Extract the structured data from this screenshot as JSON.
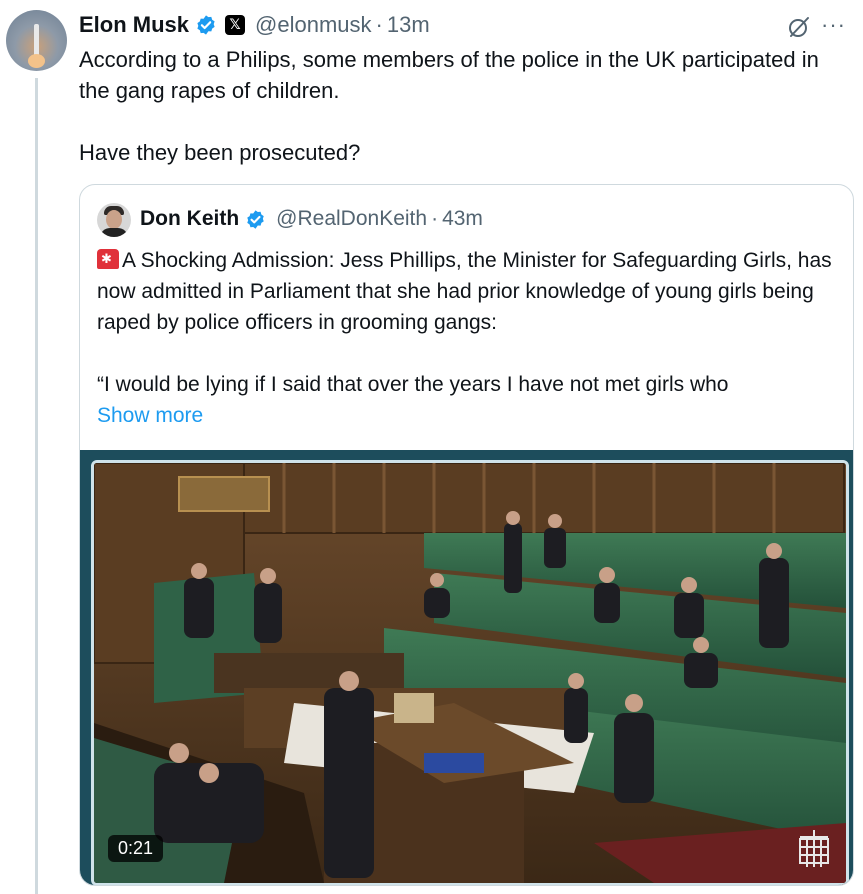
{
  "tweet": {
    "author_name": "Elon Musk",
    "author_handle": "@elonmusk",
    "separator": "·",
    "time": "13m",
    "text_line1": "According to a Philips, some members of the police in the UK participated in the gang rapes of children.",
    "text_line2": "Have they been prosecuted?"
  },
  "quote": {
    "author_name": "Don Keith",
    "author_handle": "@RealDonKeith",
    "separator": "·",
    "time": "43m",
    "para1": "A Shocking Admission: Jess Phillips, the Minister for Safeguarding Girls, has now admitted in Parliament that she had prior knowledge of young girls being raped by police officers in grooming gangs:",
    "para2": "“I would be lying if I said that over the years I have not met girls who",
    "show_more": "Show more",
    "video_duration": "0:21"
  },
  "colors": {
    "link": "#1d9bf0",
    "verified": "#1d9bf0",
    "muted": "#536471"
  },
  "icons": [
    "verified-badge-icon",
    "x-affiliate-icon",
    "grok-icon",
    "more-icon",
    "siren-icon",
    "portcullis-icon"
  ]
}
